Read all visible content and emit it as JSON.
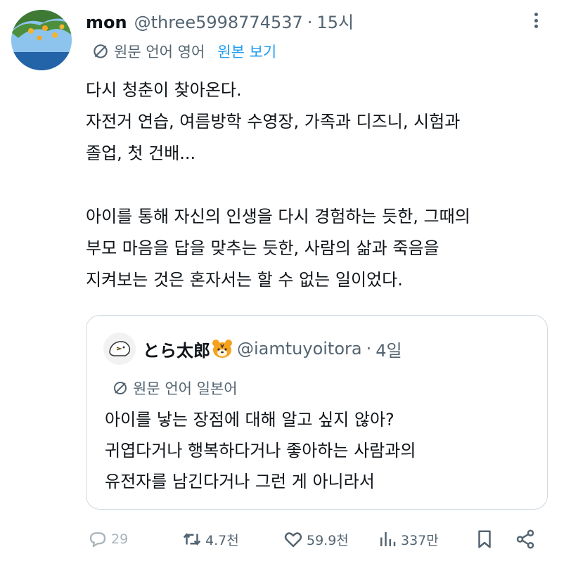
{
  "tweet": {
    "display_name": "mon",
    "handle": "@three5998774537",
    "separator": "·",
    "time": "15시",
    "original_language_label": "원문 언어 영어",
    "view_original_label": "원본 보기",
    "lines": [
      "다시 청춘이 찾아온다.",
      "자전거 연습, 여름방학 수영장, 가족과 디즈니, 시험과",
      "졸업, 첫 건배...",
      "",
      "아이를 통해 자신의 인생을 다시 경험하는 듯한, 그때의",
      "부모 마음을 답을 맞추는 듯한, 사람의 삶과 죽음을",
      "지켜보는 것은 혼자서는 할 수 없는 일이었다."
    ]
  },
  "quote": {
    "display_name": "とら太郎",
    "handle": "@iamtuyoitora",
    "separator": "·",
    "time": "4일",
    "original_language_label": "원문 언어 일본어",
    "lines": [
      "아이를 낳는 장점에 대해 알고 싶지 않아?",
      "귀엽다거나 행복하다거나 좋아하는 사람과의",
      "유전자를 남긴다거나 그런 게 아니라서"
    ]
  },
  "actions": {
    "replies": "29",
    "reposts": "4.7천",
    "likes": "59.9천",
    "views": "337만"
  },
  "colors": {
    "text": "#0f1419",
    "secondary": "#536471",
    "accent": "#1d9bf0",
    "border": "#cfd9de"
  },
  "icons": [
    "avatar",
    "more-icon",
    "translate-icon",
    "reply-icon",
    "repost-icon",
    "like-icon",
    "views-icon",
    "bookmark-icon",
    "share-icon",
    "tiger-emoji-icon"
  ]
}
